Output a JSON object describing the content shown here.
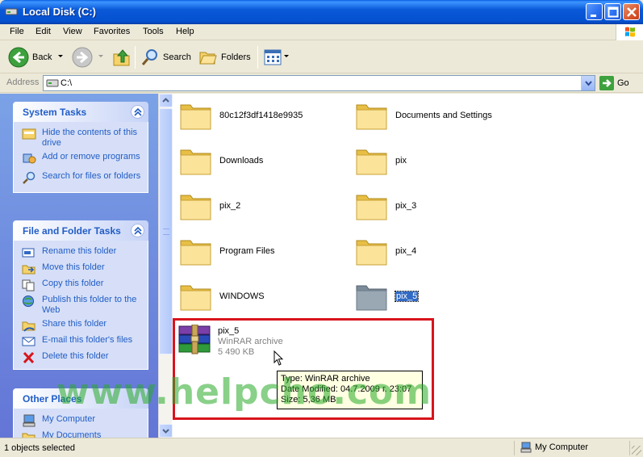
{
  "window": {
    "title": "Local Disk (C:)"
  },
  "menu": [
    "File",
    "Edit",
    "View",
    "Favorites",
    "Tools",
    "Help"
  ],
  "toolbar": {
    "back": "Back",
    "search": "Search",
    "folders": "Folders"
  },
  "address": {
    "label": "Address",
    "value": "C:\\",
    "go": "Go"
  },
  "system_tasks": {
    "title": "System Tasks",
    "items": [
      "Hide the contents of this drive",
      "Add or remove programs",
      "Search for files or folders"
    ]
  },
  "file_folder_tasks": {
    "title": "File and Folder Tasks",
    "items": [
      "Rename this folder",
      "Move this folder",
      "Copy this folder",
      "Publish this folder to the Web",
      "Share this folder",
      "E-mail this folder's files",
      "Delete this folder"
    ]
  },
  "other_places": {
    "title": "Other Places",
    "items": [
      "My Computer",
      "My Documents"
    ]
  },
  "folders": [
    {
      "name": "80c12f3df1418e9935"
    },
    {
      "name": "Documents and Settings"
    },
    {
      "name": "Downloads"
    },
    {
      "name": "pix"
    },
    {
      "name": "pix_2"
    },
    {
      "name": "pix_3"
    },
    {
      "name": "Program Files"
    },
    {
      "name": "pix_4"
    },
    {
      "name": "WINDOWS"
    },
    {
      "name": "pix_5",
      "selected": true
    }
  ],
  "archive": {
    "name": "pix_5",
    "type": "WinRAR archive",
    "size": "5 490 KB"
  },
  "tooltip": {
    "type": "Type: WinRAR archive",
    "date": "Date Modified: 04.7.2009 г. 23:07",
    "size": "Size: 5,36 MB"
  },
  "watermark": "www.helpcho.com",
  "status": {
    "left": "1 objects selected",
    "right": "My Computer"
  },
  "colors": {
    "title_bar": "#0551d0",
    "task_link": "#215dc6",
    "highlight_box": "#d8141c",
    "selection": "#316ac5"
  }
}
